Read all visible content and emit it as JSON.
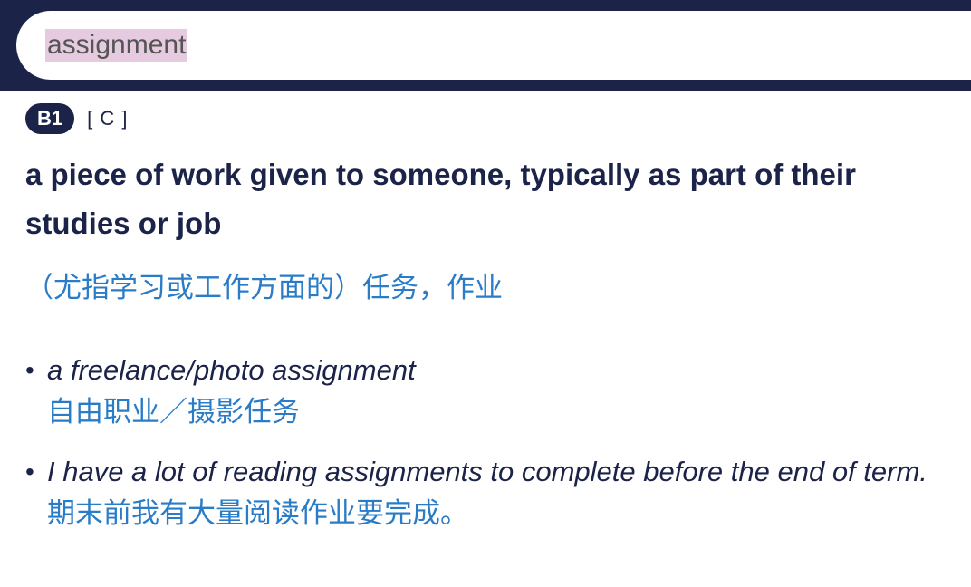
{
  "search": {
    "value": "assignment"
  },
  "entry": {
    "level": "B1",
    "grammar": "[ C ]",
    "definition": "a piece of work given to someone, typically as part of their studies or job",
    "translation": "（尤指学习或工作方面的）任务，作业",
    "examples": [
      {
        "en": "a freelance/photo assignment",
        "zh": "自由职业／摄影任务"
      },
      {
        "en": "I have a lot of reading assignments to complete before the end of term.",
        "zh": "期末前我有大量阅读作业要完成。"
      }
    ]
  },
  "colors": {
    "navy": "#1c2349",
    "translation_blue": "#2a7cc7",
    "search_highlight": "#e6cbe0"
  }
}
